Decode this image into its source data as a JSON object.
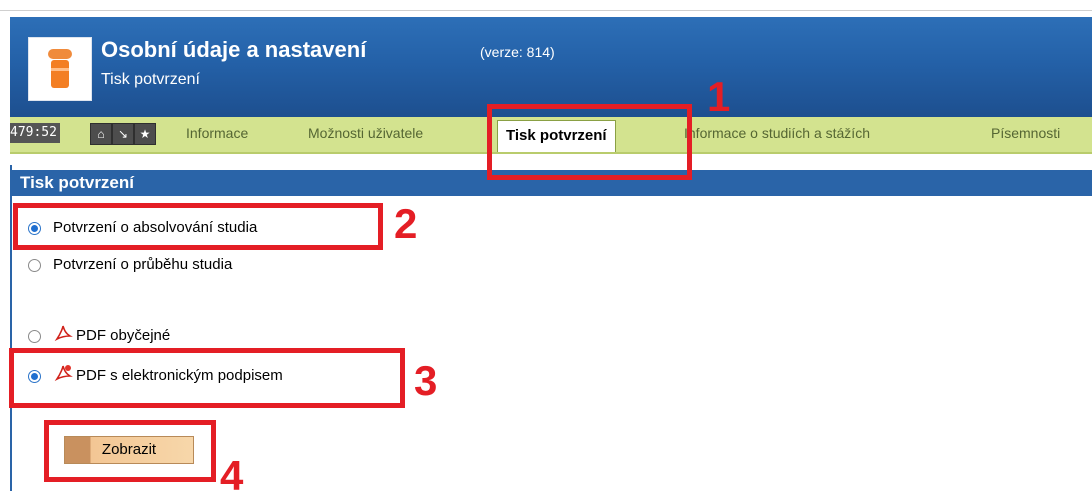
{
  "header": {
    "title": "Osobní údaje a nastavení",
    "version": "(verze: 814)",
    "subtitle": "Tisk potvrzení",
    "icon": "user-data-icon"
  },
  "tabbar": {
    "timer": "479:52",
    "buttons": [
      "home-icon",
      "arrow-down-icon",
      "star-icon"
    ],
    "tabs": [
      {
        "label": "Informace",
        "active": false
      },
      {
        "label": "Možnosti uživatele",
        "active": false
      },
      {
        "label": "Tisk potvrzení",
        "active": true
      },
      {
        "label": "Informace o studiích a stážích",
        "active": false
      },
      {
        "label": "Písemnosti",
        "active": false
      }
    ]
  },
  "section": {
    "title": "Tisk potvrzení",
    "type_options": [
      {
        "label": "Potvrzení o absolvování studia",
        "selected": true
      },
      {
        "label": "Potvrzení o průběhu studia",
        "selected": false
      }
    ],
    "format_options": [
      {
        "label": "PDF obyčejné",
        "selected": false,
        "icon": "pdf-icon"
      },
      {
        "label": "PDF s elektronickým podpisem",
        "selected": true,
        "icon": "pdf-signed-icon"
      }
    ],
    "show_button": "Zobrazit"
  },
  "annotations": {
    "numbers": [
      "1",
      "2",
      "3",
      "4"
    ],
    "color": "#e41e25"
  },
  "colors": {
    "header_blue": "#2461a8",
    "tabbar_green": "#d3e38f",
    "button_orange": "#f3c694"
  }
}
